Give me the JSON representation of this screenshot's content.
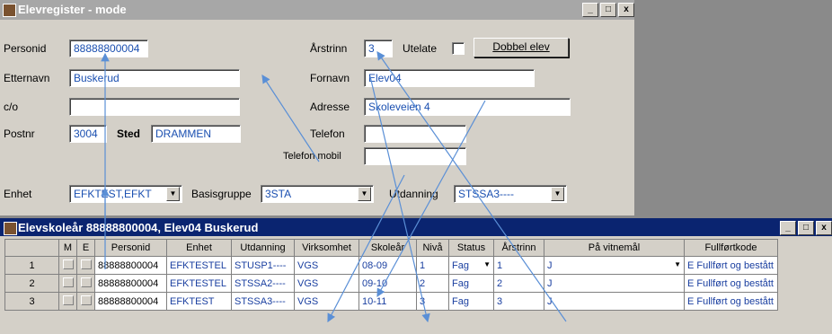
{
  "window_main": {
    "title": "Elevregister - mode",
    "buttons": [
      "_",
      "□",
      "x"
    ]
  },
  "form": {
    "personid_label": "Personid",
    "personid_value": "88888800004",
    "arstrinn_label": "Årstrinn",
    "arstrinn_value": "3",
    "utelate_label": "Utelate",
    "dobbel_button": "Dobbel elev",
    "etternavn_label": "Etternavn",
    "etternavn_value": "Buskerud",
    "fornavn_label": "Fornavn",
    "fornavn_value": "Elev04",
    "co_label": "c/o",
    "co_value": "",
    "adresse_label": "Adresse",
    "adresse_value": "Skoleveien 4",
    "postnr_label": "Postnr",
    "postnr_value": "3004",
    "sted_label": "Sted",
    "sted_value": "DRAMMEN",
    "telefon_label": "Telefon",
    "telefon_value": "",
    "telefon_mobil_label": "Telefon mobil",
    "telefon_mobil_value": "",
    "enhet_label": "Enhet",
    "enhet_value": "EFKTEST,EFKT",
    "basisgruppe_label": "Basisgruppe",
    "basisgruppe_value": "3STA",
    "utdanning_label": "Utdanning",
    "utdanning_value": "STSSA3----"
  },
  "window_grid": {
    "title": "Elevskoleår 88888800004, Elev04 Buskerud",
    "buttons": [
      "_",
      "□",
      "x"
    ],
    "columns": [
      "",
      "M",
      "E",
      "Personid",
      "Enhet",
      "Utdanning",
      "Virksomhet",
      "Skoleår",
      "Nivå",
      "Status",
      "Årstrinn",
      "På vitnemål",
      "Fullførtkode"
    ],
    "rows": [
      {
        "n": "1",
        "personid": "88888800004",
        "enhet": "EFKTESTEL",
        "utdanning": "STUSP1----",
        "virksomhet": "VGS",
        "skolear": "08-09",
        "niva": "1",
        "status": "Fag",
        "arstrinn": "1",
        "vitnemal": "J",
        "fullfort": "E Fullført og bestått"
      },
      {
        "n": "2",
        "personid": "88888800004",
        "enhet": "EFKTESTEL",
        "utdanning": "STSSA2----",
        "virksomhet": "VGS",
        "skolear": "09-10",
        "niva": "2",
        "status": "Fag",
        "arstrinn": "2",
        "vitnemal": "J",
        "fullfort": "E Fullført og bestått"
      },
      {
        "n": "3",
        "personid": "88888800004",
        "enhet": "EFKTEST",
        "utdanning": "STSSA3----",
        "virksomhet": "VGS",
        "skolear": "10-11",
        "niva": "3",
        "status": "Fag",
        "arstrinn": "3",
        "vitnemal": "J",
        "fullfort": "E Fullført og bestått"
      }
    ]
  },
  "colors": {
    "title_active": "#0a2470",
    "title_inactive": "#a7a7a7",
    "field_text": "#1a4fb0",
    "arrow": "#5a8fd6"
  }
}
